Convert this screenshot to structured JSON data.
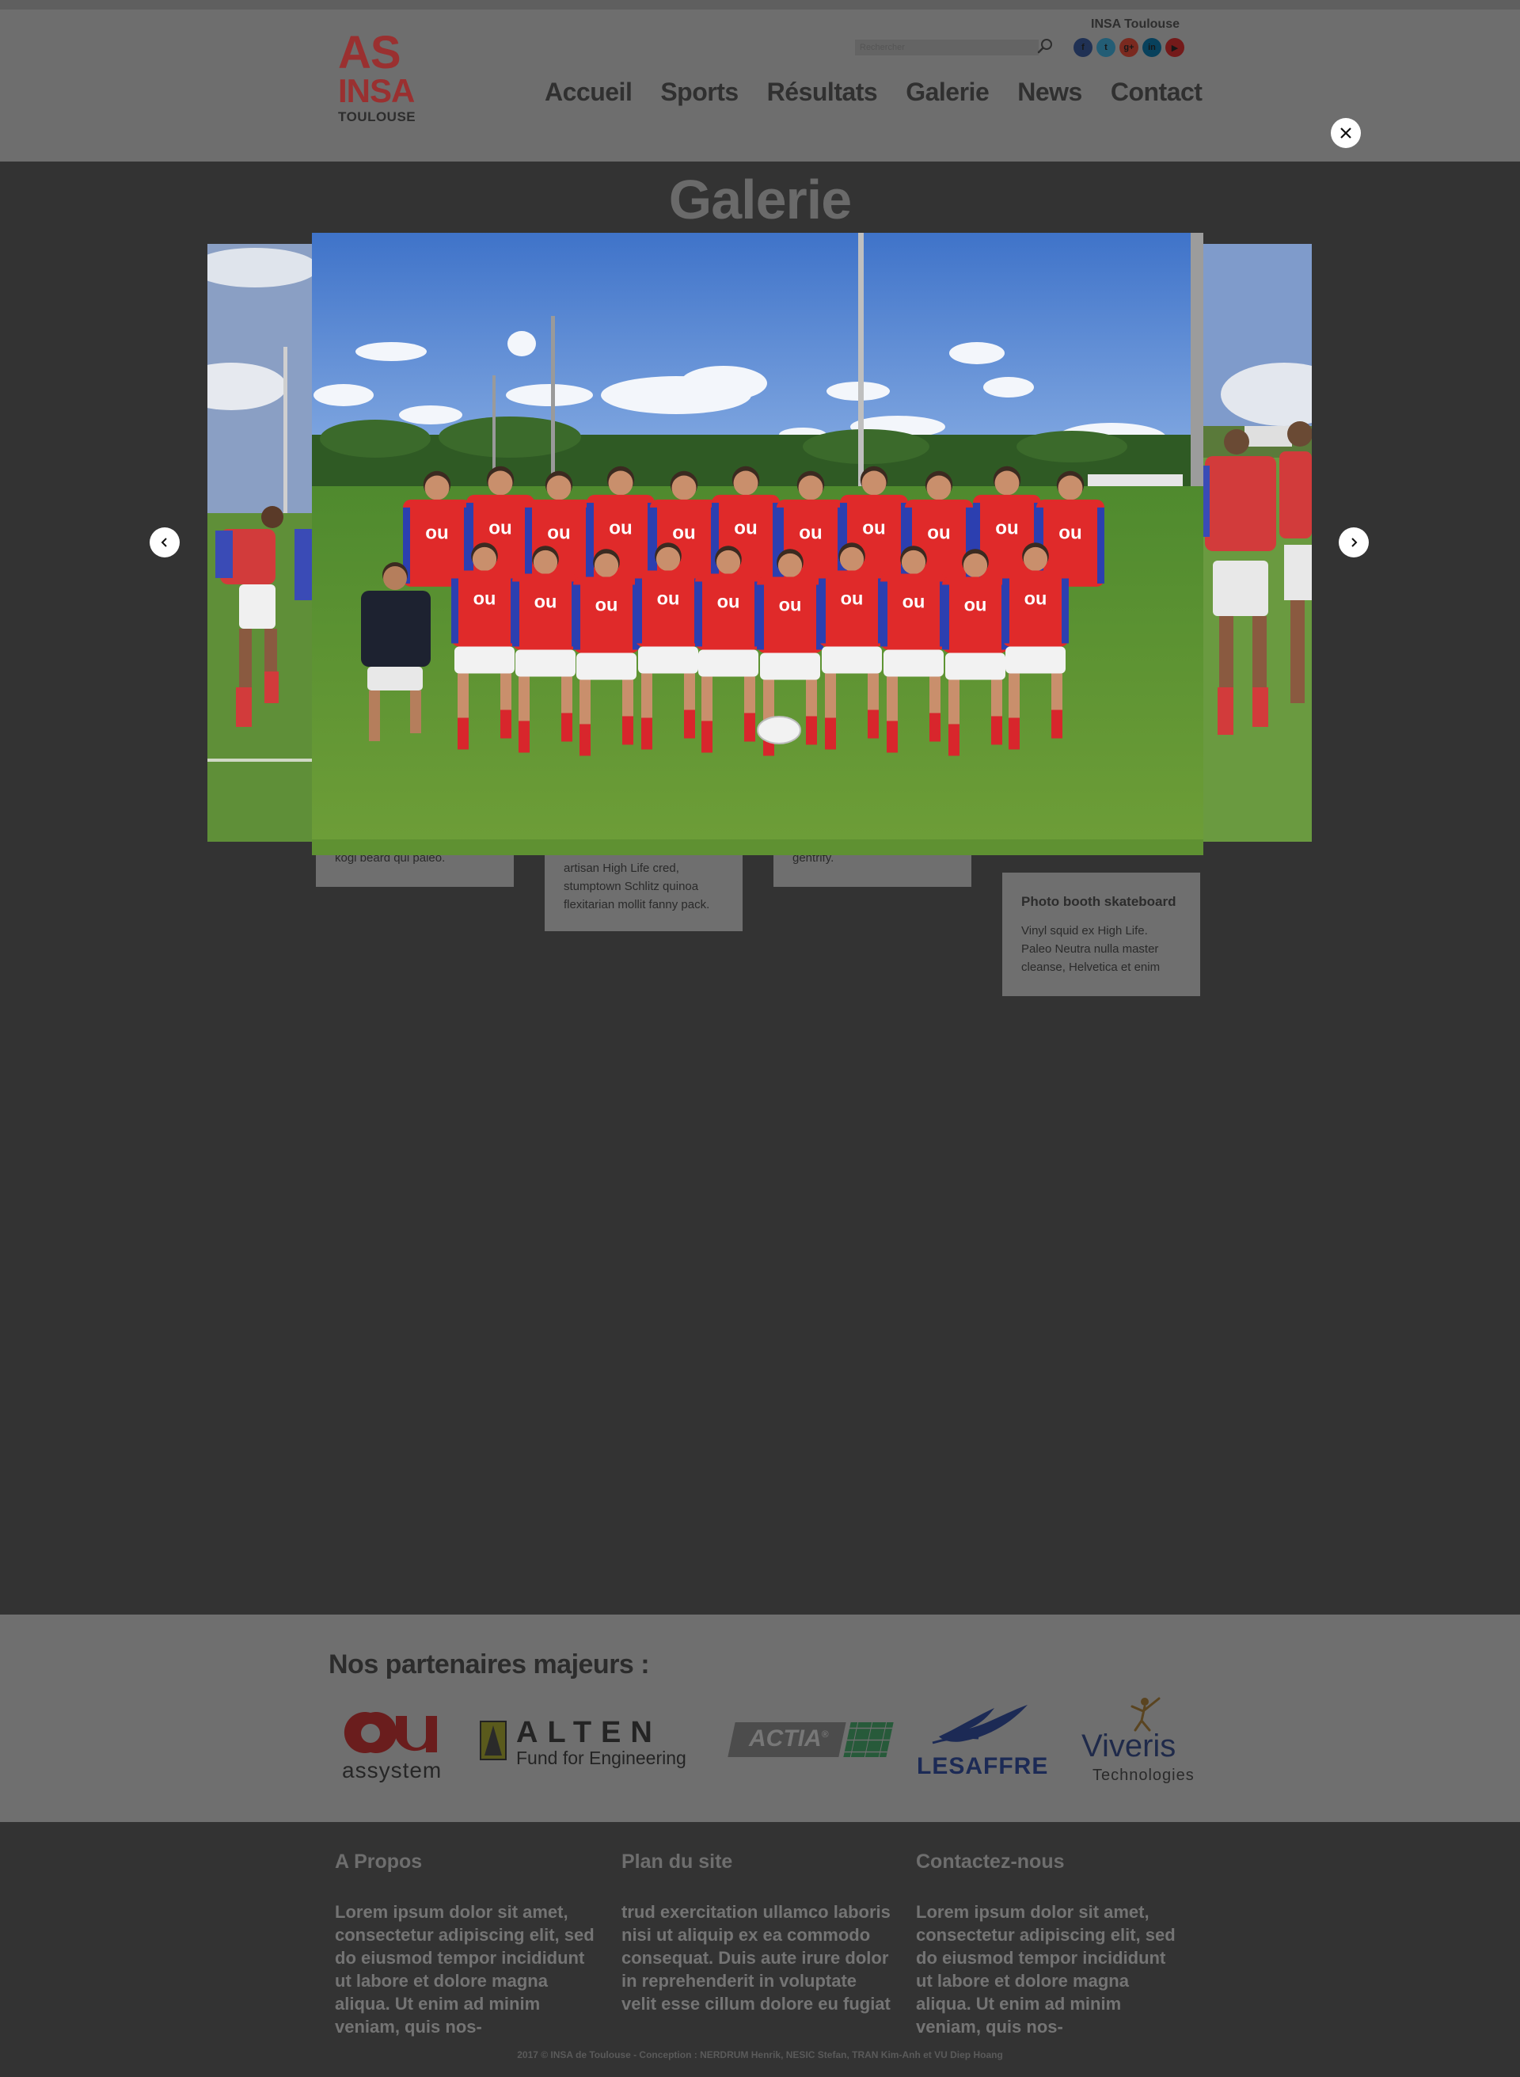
{
  "header": {
    "logo": {
      "line1": "AS",
      "line2": "INSA",
      "line3": "TOULOUSE"
    },
    "search_placeholder": "Rechercher",
    "org_name": "INSA Toulouse",
    "socials": [
      {
        "icon": "facebook-icon",
        "glyph": "f",
        "color": "#3b5998"
      },
      {
        "icon": "twitter-icon",
        "glyph": "t",
        "color": "#3fa9d5"
      },
      {
        "icon": "google-plus-icon",
        "glyph": "g+",
        "color": "#dd4b39"
      },
      {
        "icon": "linkedin-icon",
        "glyph": "in",
        "color": "#0e76a8"
      },
      {
        "icon": "youtube-icon",
        "glyph": "▶",
        "color": "#d32f2f"
      }
    ],
    "nav": [
      "Accueil",
      "Sports",
      "Résultats",
      "Galerie",
      "News",
      "Contact"
    ]
  },
  "page": {
    "title": "Galerie",
    "cards": [
      {
        "title": "",
        "text": "kogi beard qui paleo."
      },
      {
        "title": "",
        "text": "artisan High Life cred, stumptown Schlitz quinoa flexitarian mollit fanny pack."
      },
      {
        "title": "",
        "text": "gentrify."
      },
      {
        "title": "Photo booth skateboard",
        "text": "Vinyl squid ex High Life. Paleo Neutra nulla master cleanse, Helvetica et enim"
      }
    ]
  },
  "partners": {
    "title": "Nos partenaires majeurs :",
    "logos": [
      {
        "name": "assystem",
        "mark": "ou",
        "label": "assystem"
      },
      {
        "name": "alten",
        "mark": "ALTEN",
        "label": "Fund for Engineering"
      },
      {
        "name": "actia",
        "mark": "ACTIA",
        "label": "®"
      },
      {
        "name": "lesaffre",
        "mark": "",
        "label": "LESAFFRE"
      },
      {
        "name": "viveris",
        "mark": "Viveris",
        "label": "Technologies"
      }
    ]
  },
  "footer": {
    "columns": [
      {
        "title": "A Propos",
        "text": "Lorem ipsum dolor sit amet, consectetur adipiscing elit, sed do eiusmod tempor incididunt ut labore et dolore magna aliqua. Ut enim ad minim veniam, quis nos-"
      },
      {
        "title": "Plan du site",
        "text": "trud exercitation ullamco laboris nisi ut aliquip ex ea commodo consequat. Duis aute irure dolor in reprehenderit in voluptate velit esse cillum dolore eu fugiat"
      },
      {
        "title": "Contactez-nous",
        "text": "Lorem ipsum dolor sit amet, consectetur adipiscing elit, sed do eiusmod tempor incididunt ut labore et dolore magna aliqua. Ut enim ad minim veniam, quis nos-"
      }
    ],
    "copyright": "2017 © INSA de Toulouse - Conception : NERDRUM Henrik, NESIC Stefan, TRAN Kim-Anh et VU Diep Hoang"
  },
  "lightbox": {
    "close_icon": "close-icon",
    "prev_icon": "chevron-left-icon",
    "next_icon": "chevron-right-icon",
    "jersey_logo": "ou"
  }
}
